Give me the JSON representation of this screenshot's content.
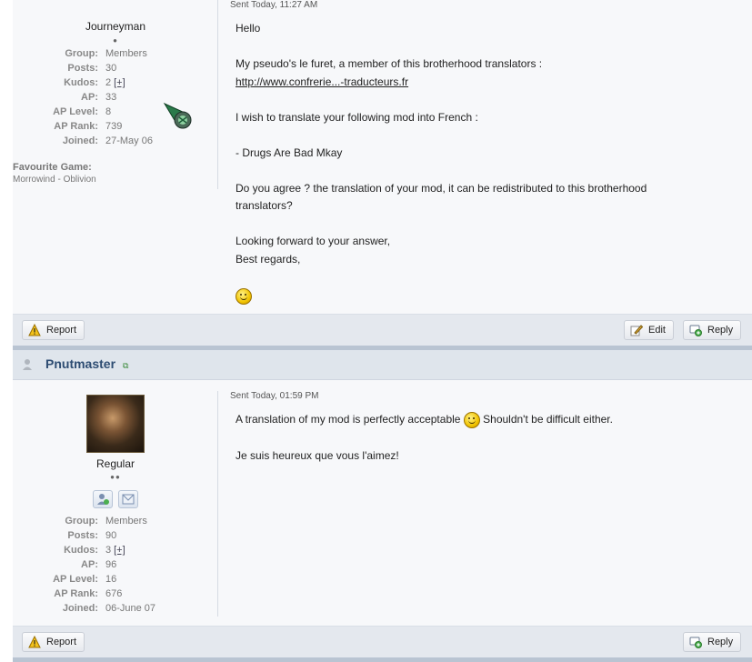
{
  "post1": {
    "sent": "Sent Today, 11:27 AM",
    "rank": "Journeyman",
    "rank_pips": "●",
    "stats": [
      {
        "label": "Group:",
        "value": "Members"
      },
      {
        "label": "Posts:",
        "value": "30"
      },
      {
        "label": "Kudos:",
        "value": "2",
        "plus": "[+]"
      },
      {
        "label": "AP:",
        "value": "33"
      },
      {
        "label": "AP Level:",
        "value": "8"
      },
      {
        "label": "AP Rank:",
        "value": "739"
      },
      {
        "label": "Joined:",
        "value": "27-May 06"
      }
    ],
    "favourite_label": "Favourite Game:",
    "favourite_value": "Morrowind - Oblivion",
    "message": {
      "l1": "Hello",
      "l2": "My pseudo's le furet, a member of this brotherhood translators :",
      "link": "http://www.confrerie...-traducteurs.fr",
      "l3": "I wish to translate your following mod into French :",
      "l4": "- Drugs Are Bad Mkay",
      "l5": "Do you agree ? the translation of your mod, it can be redistributed to this brotherhood",
      "l6": "translators?",
      "l7": "Looking forward to your answer,",
      "l8": "Best regards,"
    },
    "buttons": {
      "report": "Report",
      "edit": "Edit",
      "reply": "Reply"
    }
  },
  "post2": {
    "username": "Pnutmaster",
    "sent": "Sent Today, 01:59 PM",
    "rank": "Regular",
    "rank_pips": "●●",
    "stats": [
      {
        "label": "Group:",
        "value": "Members"
      },
      {
        "label": "Posts:",
        "value": "90"
      },
      {
        "label": "Kudos:",
        "value": "3",
        "plus": "[+]"
      },
      {
        "label": "AP:",
        "value": "96"
      },
      {
        "label": "AP Level:",
        "value": "16"
      },
      {
        "label": "AP Rank:",
        "value": "676"
      },
      {
        "label": "Joined:",
        "value": "06-June 07"
      }
    ],
    "message": {
      "l1a": "A translation of my mod is perfectly acceptable",
      "l1b": "Shouldn't be difficult either.",
      "l2": "Je suis heureux que vous l'aimez!"
    },
    "buttons": {
      "report": "Report",
      "reply": "Reply"
    }
  },
  "colors": {
    "username": "#2d4c72",
    "toolbar": "#e4e8ee",
    "separator": "#b9c4d2",
    "header": "#dfe5ec"
  },
  "icons": [
    "warning-icon",
    "edit-icon",
    "reply-icon",
    "user-offline-icon",
    "external-link-icon",
    "smiley-icon",
    "wink-smiley-icon",
    "add-friend-icon",
    "message-icon"
  ]
}
